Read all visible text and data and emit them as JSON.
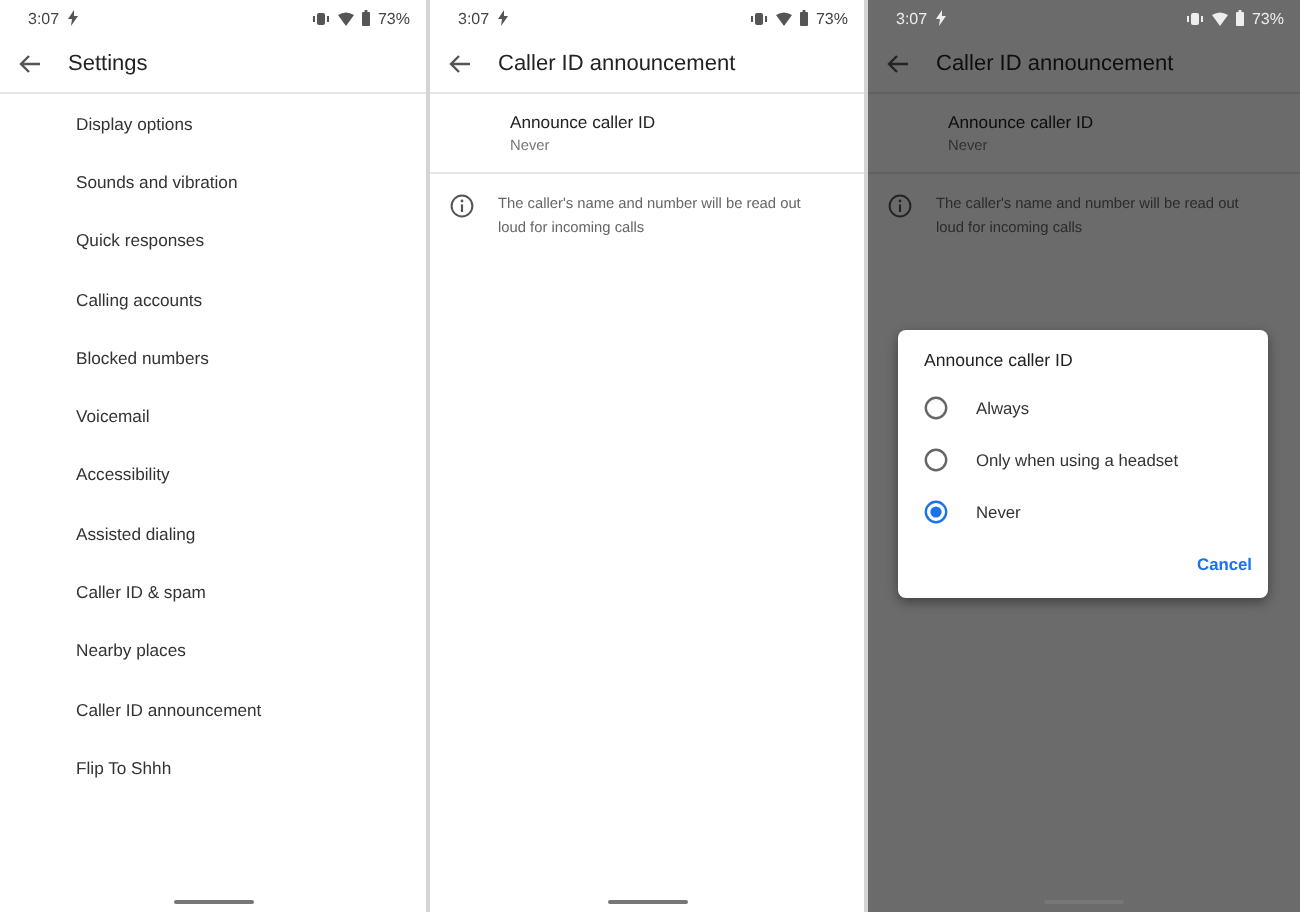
{
  "screens": [
    {
      "kind": "list",
      "dimmed": false,
      "status_bar": {
        "time": "3:07",
        "battery": "73%"
      },
      "title": "Settings",
      "items": [
        "Display options",
        "Sounds and vibration",
        "Quick responses",
        "Calling accounts",
        "Blocked numbers",
        "Voicemail",
        "Accessibility",
        "Assisted dialing",
        "Caller ID & spam",
        "Nearby places",
        "Caller ID announcement",
        "Flip To Shhh"
      ]
    },
    {
      "kind": "detail",
      "dimmed": false,
      "status_bar": {
        "time": "3:07",
        "battery": "73%"
      },
      "title": "Caller ID announcement",
      "setting": {
        "label": "Announce caller ID",
        "value": "Never"
      },
      "info": "The caller's name and number will be read out loud for incoming calls"
    },
    {
      "kind": "detail",
      "dimmed": true,
      "status_bar": {
        "time": "3:07",
        "battery": "73%"
      },
      "title": "Caller ID announcement",
      "setting": {
        "label": "Announce caller ID",
        "value": "Never"
      },
      "info": "The caller's name and number will be read out loud for incoming calls",
      "dialog": {
        "title": "Announce caller ID",
        "options": [
          {
            "label": "Always",
            "selected": false
          },
          {
            "label": "Only when using a headset",
            "selected": false
          },
          {
            "label": "Never",
            "selected": true
          }
        ],
        "button": "Cancel"
      }
    }
  ]
}
